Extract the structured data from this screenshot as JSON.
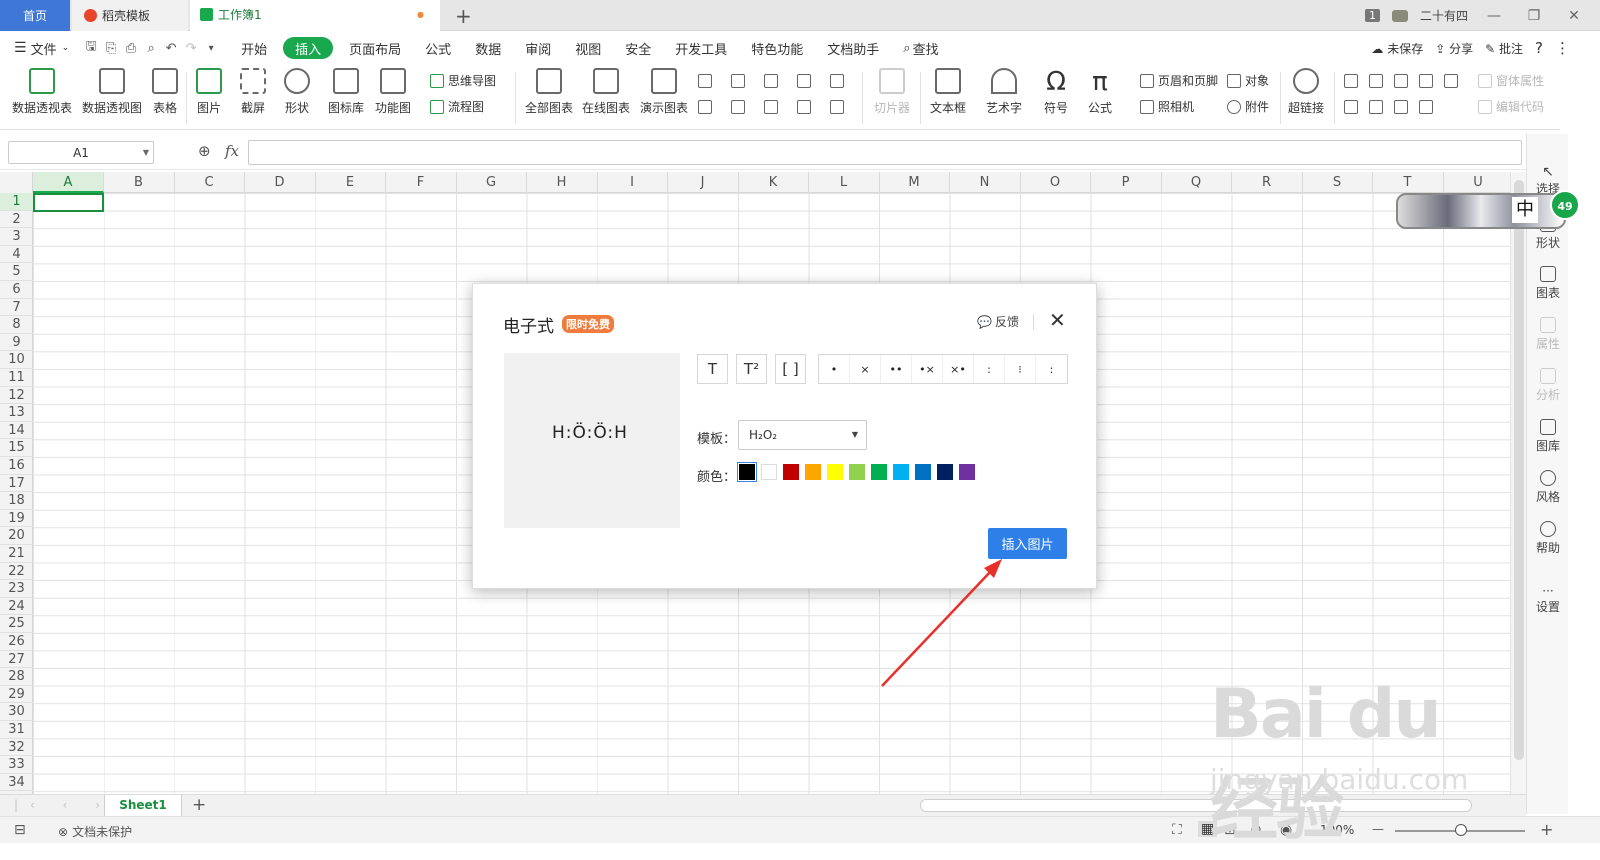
{
  "tabs": {
    "home": "首页",
    "docer": "稻壳模板",
    "workbook": "工作簿1",
    "modified_dot": "●",
    "add": "+"
  },
  "titlebar": {
    "count_badge": "1",
    "user": "二十有四",
    "min": "—",
    "restore": "❐",
    "close": "✕"
  },
  "menu": {
    "file": "文件",
    "items": [
      "开始",
      "插入",
      "页面布局",
      "公式",
      "数据",
      "审阅",
      "视图",
      "安全",
      "开发工具",
      "特色功能",
      "文档助手"
    ],
    "active": "插入",
    "search": "查找",
    "unsaved": "未保存",
    "share": "分享",
    "comment": "批注",
    "help": "?",
    "more": "⋮"
  },
  "ribbon": {
    "pivot_table": "数据透视表",
    "pivot_chart": "数据透视图",
    "table": "表格",
    "picture": "图片",
    "screenshot": "截屏",
    "shape": "形状",
    "icon_lib": "图标库",
    "func_chart": "功能图",
    "mindmap": "思维导图",
    "flowchart": "流程图",
    "all_charts": "全部图表",
    "online_charts": "在线图表",
    "demo_charts": "演示图表",
    "slicer": "切片器",
    "textbox": "文本框",
    "wordart": "艺术字",
    "symbol": "符号",
    "formula": "公式",
    "header_footer": "页眉和页脚",
    "camera": "照相机",
    "object": "对象",
    "attachment": "附件",
    "hyperlink": "超链接",
    "window_props": "窗体属性",
    "edit_code": "编辑代码"
  },
  "formula_bar": {
    "cell_ref": "A1",
    "fx": "fx",
    "value": ""
  },
  "grid": {
    "columns": [
      "A",
      "B",
      "C",
      "D",
      "E",
      "F",
      "G",
      "H",
      "I",
      "J",
      "K",
      "L",
      "M",
      "N",
      "O",
      "P",
      "Q",
      "R",
      "S",
      "T",
      "U"
    ],
    "rows": [
      "1",
      "2",
      "3",
      "4",
      "5",
      "6",
      "7",
      "8",
      "9",
      "10",
      "11",
      "12",
      "13",
      "14",
      "15",
      "16",
      "17",
      "18",
      "19",
      "20",
      "21",
      "22",
      "23",
      "24",
      "25",
      "26",
      "27",
      "28",
      "29",
      "30",
      "31",
      "32",
      "33",
      "34"
    ]
  },
  "right_panel": {
    "select": "选择",
    "shape": "形状",
    "chart": "图表",
    "props": "属性",
    "analyze": "分析",
    "gallery": "图库",
    "style": "风格",
    "help": "帮助",
    "settings": "设置",
    "more": "···"
  },
  "avatar": {
    "char": "中",
    "count": "49"
  },
  "sheets": {
    "nav": "|‹ ‹ › ›|",
    "active": "Sheet1",
    "add": "+"
  },
  "status": {
    "protect": "文档未保护",
    "zoom": "100%",
    "minus": "—",
    "plus": "+"
  },
  "dialog": {
    "title": "电子式",
    "badge": "限时免费",
    "feedback": "反馈",
    "close": "✕",
    "preview_formula": "H:Ö:Ö:H",
    "tools": [
      "T",
      "T²",
      "[ ]"
    ],
    "dot_tools": [
      "•",
      "×",
      "••",
      "•×",
      "×•",
      ":",
      "⁝",
      ":"
    ],
    "template_label": "模板：",
    "template_value": "H₂O₂",
    "color_label": "颜色：",
    "colors": [
      "#000000",
      "#ffffff",
      "#c00000",
      "#ffa500",
      "#ffff00",
      "#92d050",
      "#00b050",
      "#00b0f0",
      "#0070c0",
      "#002060",
      "#7030a0"
    ],
    "selected_color": "#000000",
    "insert_button": "插入图片"
  },
  "watermark": {
    "brand": "Bai du 经验",
    "url": "jingyan.baidu.com"
  }
}
